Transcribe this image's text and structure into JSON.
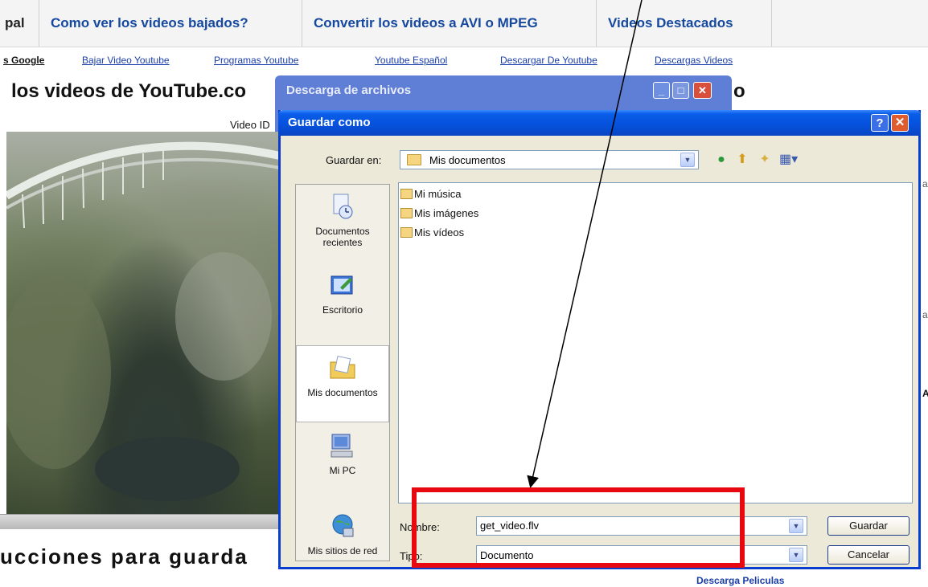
{
  "nav": {
    "items": [
      "pal",
      "Como ver los videos bajados?",
      "Convertir los videos a AVI o MPEG",
      "Videos Destacados"
    ]
  },
  "links": [
    "s Google",
    "Bajar Video Youtube",
    "Programas Youtube",
    "Youtube Español",
    "Descargar De Youtube",
    "Descargas Videos"
  ],
  "page": {
    "heading": "los videos de YouTube.co",
    "heading_tail": "o",
    "video_id_label": "Video ID",
    "instructions_heading": "ucciones para guarda",
    "bottom_link": "Descarga Peliculas"
  },
  "download_dialog": {
    "title": "Descarga de archivos"
  },
  "save_dialog": {
    "title": "Guardar como",
    "look_in_label": "Guardar en:",
    "look_in_value": "Mis documentos",
    "places": [
      "Documentos recientes",
      "Escritorio",
      "Mis documentos",
      "Mi PC",
      "Mis sitios de red"
    ],
    "selected_place": "Mis documentos",
    "files": [
      "Mi música",
      "Mis imágenes",
      "Mis vídeos"
    ],
    "filename_label": "Nombre:",
    "filename_value": "get_video.flv",
    "filetype_label": "Tipo:",
    "filetype_value": "Documento",
    "save_button": "Guardar",
    "cancel_button": "Cancelar"
  },
  "colors": {
    "highlight_box": "#e8080f",
    "titlebar": "#0553e0",
    "nav_link": "#15489e"
  }
}
